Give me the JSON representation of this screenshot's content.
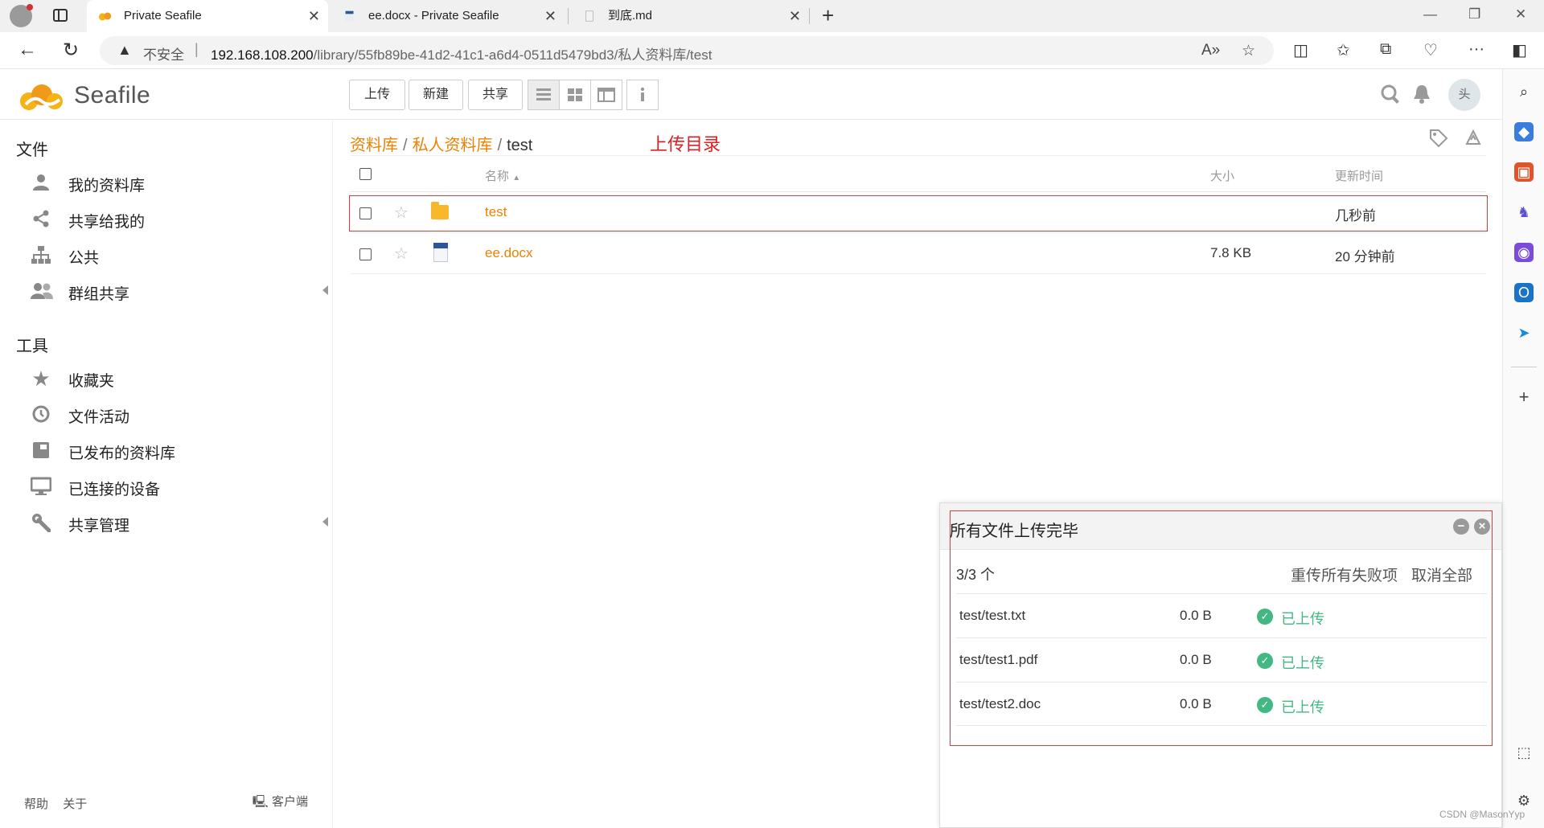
{
  "browser": {
    "tabs": [
      {
        "title": "Private Seafile"
      },
      {
        "title": "ee.docx - Private Seafile"
      },
      {
        "title": "到底.md"
      }
    ],
    "address": {
      "insecure_label": "不安全",
      "host": "192.168.108.200",
      "path": "/library/55fb89be-41d2-41c1-a6d4-0511d5479bd3/私人资料库/test"
    }
  },
  "app": {
    "logo_text": "Seafile",
    "toolbar": {
      "upload": "上传",
      "new": "新建",
      "share": "共享"
    },
    "avatar_alt": "头"
  },
  "sidebar": {
    "files_title": "文件",
    "files_items": [
      {
        "label": "我的资料库"
      },
      {
        "label": "共享给我的"
      },
      {
        "label": "公共"
      },
      {
        "label": "群组共享"
      }
    ],
    "tools_title": "工具",
    "tools_items": [
      {
        "label": "收藏夹"
      },
      {
        "label": "文件活动"
      },
      {
        "label": "已发布的资料库"
      },
      {
        "label": "已连接的设备"
      },
      {
        "label": "共享管理"
      }
    ],
    "footer": {
      "help": "帮助",
      "about": "关于",
      "client": "客户端"
    }
  },
  "main": {
    "breadcrumb": [
      "资料库",
      "私人资料库",
      "test"
    ],
    "annotation": "上传目录",
    "columns": {
      "name": "名称",
      "size": "大小",
      "modified": "更新时间"
    },
    "rows": [
      {
        "name": "test",
        "size": "",
        "time": "几秒前",
        "type": "folder"
      },
      {
        "name": "ee.docx",
        "size": "7.8 KB",
        "time": "20 分钟前",
        "type": "docx"
      }
    ]
  },
  "upload_panel": {
    "title": "所有文件上传完毕",
    "count": "3/3 个",
    "retry_all": "重传所有失败项",
    "cancel_all": "取消全部",
    "items": [
      {
        "file": "test/test.txt",
        "size": "0.0 B",
        "status": "已上传"
      },
      {
        "file": "test/test1.pdf",
        "size": "0.0 B",
        "status": "已上传"
      },
      {
        "file": "test/test2.doc",
        "size": "0.0 B",
        "status": "已上传"
      }
    ]
  },
  "watermark": "CSDN @MasonYyp",
  "colors": {
    "link_orange": "#eb8205",
    "success_green": "#42b883",
    "annotation_red": "#e53935"
  }
}
